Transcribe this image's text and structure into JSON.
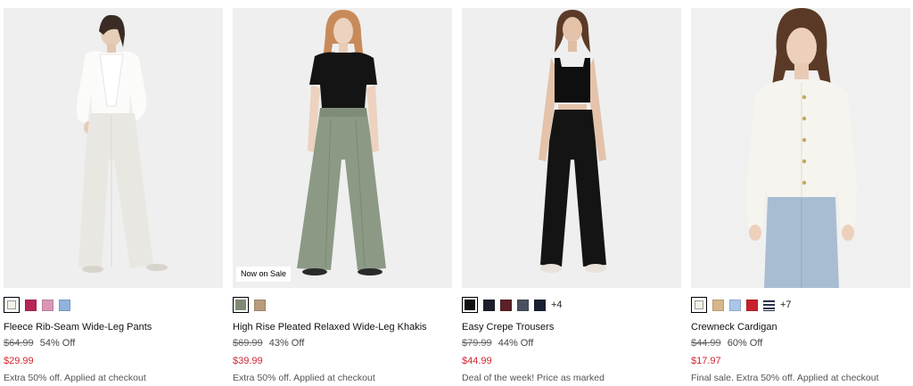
{
  "products": [
    {
      "name": "Fleece Rib-Seam Wide-Leg Pants",
      "original_price": "$64.99",
      "discount": "54% Off",
      "sale_price": "$29.99",
      "promo": "Extra 50% off. Applied at checkout",
      "swatch_colors": [
        "#f3f1ea",
        "#b7265a",
        "#d996b5",
        "#8fb3dc"
      ],
      "more_colors": ""
    },
    {
      "name": "High Rise Pleated Relaxed Wide-Leg Khakis",
      "original_price": "$69.99",
      "discount": "43% Off",
      "sale_price": "$39.99",
      "promo": "Extra 50% off. Applied at checkout",
      "badge": "Now on Sale",
      "swatch_colors": [
        "#7f8a75",
        "#b89c7c"
      ],
      "more_colors": ""
    },
    {
      "name": "Easy Crepe Trousers",
      "original_price": "$79.99",
      "discount": "44% Off",
      "sale_price": "$44.99",
      "promo": "Deal of the week! Price as marked",
      "swatch_colors": [
        "#111111",
        "#1c1f2b",
        "#5a2226",
        "#4a5060",
        "#1a2033"
      ],
      "more_colors": "+4"
    },
    {
      "name": "Crewneck Cardigan",
      "original_price": "$44.99",
      "discount": "60% Off",
      "sale_price": "$17.97",
      "promo": "Final sale. Extra 50% off. Applied at checkout",
      "swatch_colors": [
        "#f2efe6",
        "#d9b688",
        "#a9c6ea",
        "#c8222c",
        "#2b3550"
      ],
      "more_colors": "+7"
    }
  ]
}
